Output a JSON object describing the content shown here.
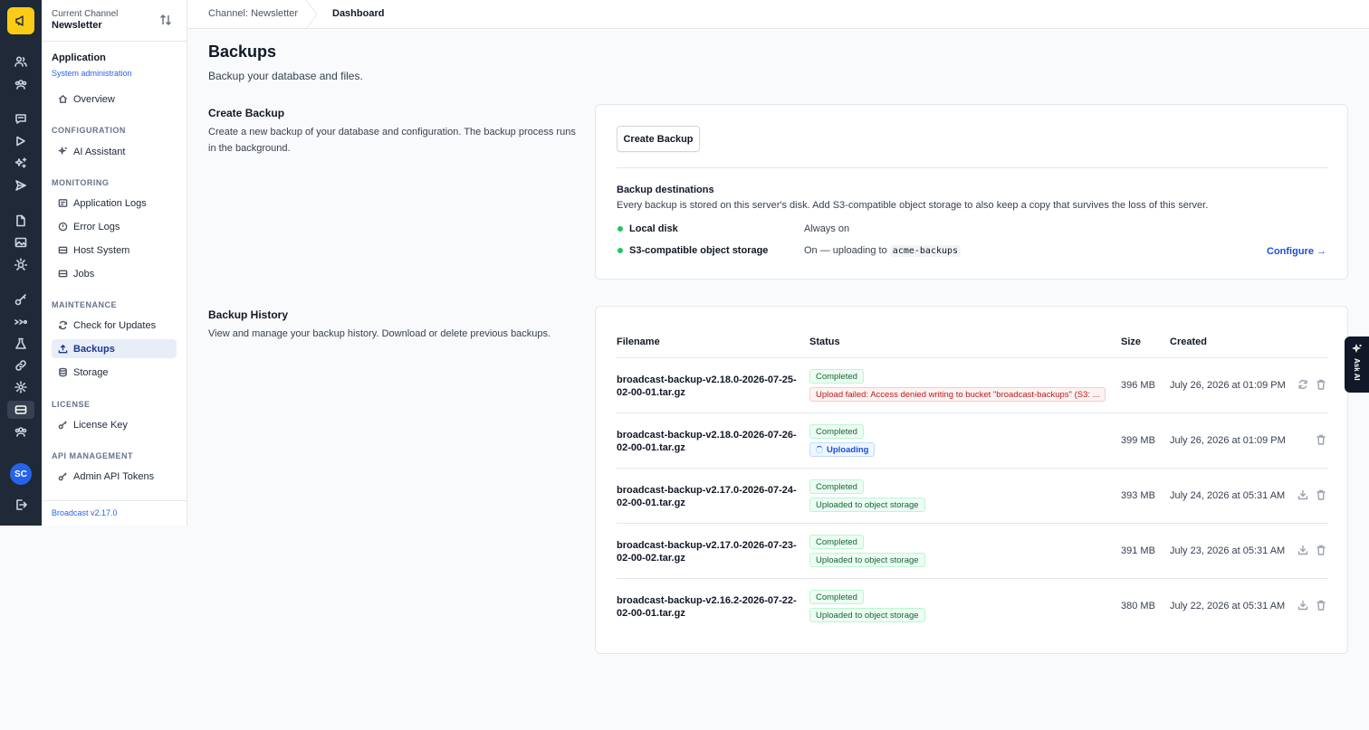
{
  "rail": {
    "avatar_initials": "SC",
    "icons": [
      "users-icon",
      "team-icon",
      "chat-icon",
      "play-icon",
      "sparkle-icon",
      "send-icon",
      "document-icon",
      "image-icon",
      "bug-icon",
      "key-icon",
      "workflow-icon",
      "flask-icon",
      "link-icon",
      "settings-icon",
      "database-icon",
      "gear-users-icon",
      "logout-icon"
    ]
  },
  "channel": {
    "label": "Current Channel",
    "name": "Newsletter"
  },
  "sidebar": {
    "app_title": "Application",
    "app_subtitle": "System administration",
    "overview": "Overview",
    "sections": {
      "configuration": "CONFIGURATION",
      "monitoring": "MONITORING",
      "maintenance": "MAINTENANCE",
      "license": "LICENSE",
      "api": "API MANAGEMENT"
    },
    "items": {
      "ai_assistant": "AI Assistant",
      "app_logs": "Application Logs",
      "error_logs": "Error Logs",
      "host_system": "Host System",
      "jobs": "Jobs",
      "check_updates": "Check for Updates",
      "backups": "Backups",
      "storage": "Storage",
      "license_key": "License Key",
      "api_tokens": "Admin API Tokens"
    },
    "version": "Broadcast v2.17.0"
  },
  "breadcrumb": {
    "channel": "Channel: Newsletter",
    "current": "Dashboard"
  },
  "page": {
    "title": "Backups",
    "subtitle": "Backup your database and files."
  },
  "create": {
    "title": "Create Backup",
    "description": "Create a new backup of your database and configuration. The backup process runs in the background.",
    "button": "Create Backup",
    "dest_title": "Backup destinations",
    "dest_desc": "Every backup is stored on this server's disk. Add S3-compatible object storage to also keep a copy that survives the loss of this server.",
    "destinations": [
      {
        "name": "Local disk",
        "state": "Always on"
      },
      {
        "name": "S3-compatible object storage",
        "state": "On — uploading to",
        "bucket": "acme-backups"
      }
    ],
    "configure": "Configure →",
    "status_color": "#22c55e"
  },
  "history": {
    "title": "Backup History",
    "description": "View and manage your backup history. Download or delete previous backups.",
    "columns": {
      "filename": "Filename",
      "status": "Status",
      "size": "Size",
      "created": "Created"
    },
    "rows": [
      {
        "file": "broadcast-backup-v2.18.0-2026-07-25-02-00-01.tar.gz",
        "status": "Completed",
        "sub": "Upload failed: Access denied writing to bucket \"broadcast-backups\" (S3: ...",
        "size": "396 MB",
        "created": "July 26, 2026 at 01:09 PM"
      },
      {
        "file": "broadcast-backup-v2.18.0-2026-07-26-02-00-01.tar.gz",
        "status": "Completed",
        "sub": "Uploading",
        "size": "399 MB",
        "created": "July 26, 2026 at 01:09 PM"
      },
      {
        "file": "broadcast-backup-v2.17.0-2026-07-24-02-00-01.tar.gz",
        "status": "Completed",
        "sub": "Uploaded to object storage",
        "size": "393 MB",
        "created": "July 24, 2026 at 05:31 AM"
      },
      {
        "file": "broadcast-backup-v2.17.0-2026-07-23-02-00-02.tar.gz",
        "status": "Completed",
        "sub": "Uploaded to object storage",
        "size": "391 MB",
        "created": "July 23, 2026 at 05:31 AM"
      },
      {
        "file": "broadcast-backup-v2.16.2-2026-07-22-02-00-01.tar.gz",
        "status": "Completed",
        "sub": "Uploaded to object storage",
        "size": "380 MB",
        "created": "July 22, 2026 at 05:31 AM"
      }
    ]
  },
  "ask_ai": "Ask AI"
}
